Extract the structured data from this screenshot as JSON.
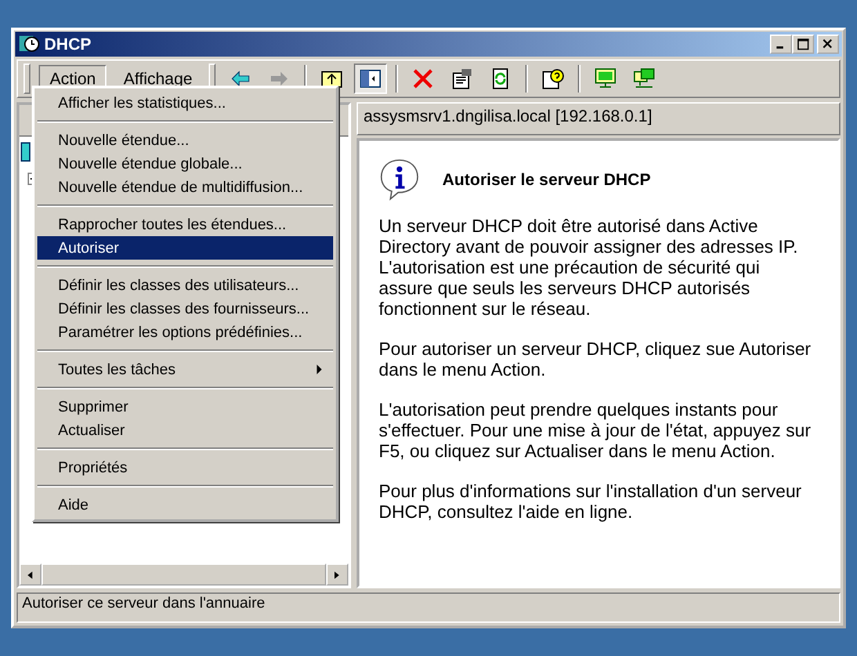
{
  "window": {
    "title": "DHCP"
  },
  "menubar": [
    {
      "label": "Action",
      "selected": true
    },
    {
      "label": "Affichage",
      "selected": false
    }
  ],
  "toolbar": [
    {
      "kind": "back",
      "disabled": false
    },
    {
      "kind": "forward",
      "disabled": true
    },
    {
      "kind": "sep"
    },
    {
      "kind": "up"
    },
    {
      "kind": "tree",
      "pressed": true
    },
    {
      "kind": "sep"
    },
    {
      "kind": "delete"
    },
    {
      "kind": "properties"
    },
    {
      "kind": "refresh"
    },
    {
      "kind": "sep"
    },
    {
      "kind": "help"
    },
    {
      "kind": "sep"
    },
    {
      "kind": "monitor"
    },
    {
      "kind": "monitors"
    }
  ],
  "menu": [
    {
      "kind": "item",
      "label": "Afficher les statistiques...",
      "selected": false
    },
    {
      "kind": "separator"
    },
    {
      "kind": "item",
      "label": "Nouvelle étendue...",
      "selected": false
    },
    {
      "kind": "item",
      "label": "Nouvelle étendue globale...",
      "selected": false
    },
    {
      "kind": "item",
      "label": "Nouvelle étendue de multidiffusion...",
      "selected": false
    },
    {
      "kind": "separator"
    },
    {
      "kind": "item",
      "label": "Rapprocher toutes les étendues...",
      "selected": false
    },
    {
      "kind": "item",
      "label": "Autoriser",
      "selected": true
    },
    {
      "kind": "separator"
    },
    {
      "kind": "item",
      "label": "Définir les classes des utilisateurs...",
      "selected": false
    },
    {
      "kind": "item",
      "label": "Définir les classes des fournisseurs...",
      "selected": false
    },
    {
      "kind": "item",
      "label": "Paramétrer les options prédéfinies...",
      "selected": false
    },
    {
      "kind": "separator"
    },
    {
      "kind": "item",
      "label": "Toutes les tâches",
      "selected": false,
      "submenu": true
    },
    {
      "kind": "separator"
    },
    {
      "kind": "item",
      "label": "Supprimer",
      "selected": false
    },
    {
      "kind": "item",
      "label": "Actualiser",
      "selected": false
    },
    {
      "kind": "separator"
    },
    {
      "kind": "item",
      "label": "Propriétés",
      "selected": false
    },
    {
      "kind": "separator"
    },
    {
      "kind": "item",
      "label": "Aide",
      "selected": false
    }
  ],
  "right_pane": {
    "header": "assysmsrv1.dngilisa.local [192.168.0.1]",
    "title": "Autoriser le serveur DHCP",
    "paragraphs": [
      "Un serveur DHCP doit être autorisé dans Active Directory avant de pouvoir assigner des adresses IP. L'autorisation est une précaution de sécurité qui assure que seuls les serveurs DHCP autorisés fonctionnent sur le réseau.",
      "Pour autoriser un serveur DHCP, cliquez sue Autoriser dans le menu Action.",
      "L'autorisation peut prendre quelques instants pour s'effectuer. Pour une mise à jour de l'état, appuyez sur F5, ou cliquez sur Actualiser dans le menu Action.",
      "Pour plus d'informations sur l'installation d'un serveur DHCP, consultez l'aide en ligne."
    ]
  },
  "status_bar": "Autoriser ce serveur dans l'annuaire"
}
